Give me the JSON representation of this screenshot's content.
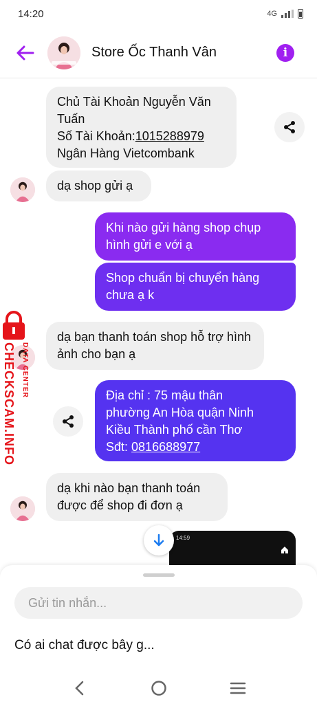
{
  "status_bar": {
    "time": "14:20",
    "network": "4G"
  },
  "header": {
    "title": "Store Ốc Thanh Vân"
  },
  "messages": [
    {
      "lines": [
        "Chủ Tài Khoản Nguyễn Văn",
        "Tuấn",
        "Số Tài Khoản:",
        "1015288979",
        "Ngân Hàng Vietcombank"
      ]
    },
    {
      "text": "dạ shop gửi ạ"
    },
    {
      "text": "Khi nào gửi hàng shop chụp hình gửi e với ạ"
    },
    {
      "text": "Shop chuẩn bị chuyển hàng chưa ạ k"
    },
    {
      "text": "dạ bạn thanh toán shop hỗ trợ hình ảnh cho bạn ạ"
    },
    {
      "lines": [
        "Địa chỉ : 75 mậu thân",
        "phường An Hòa quận Ninh",
        "Kiều Thành phố cần Thơ",
        "Sđt: ",
        "0816688977"
      ]
    },
    {
      "text": "dạ khi nào bạn thanh toán được để shop đi đơn ạ"
    }
  ],
  "watermark": {
    "line1": "DATA CENTER",
    "line2": "CHECKSCAM.INFO"
  },
  "phone_thumb": {
    "time": "14:59"
  },
  "composer": {
    "placeholder": "Gửi tin nhắn...",
    "suggestion": "Có ai chat được bây g..."
  },
  "colors": {
    "accent": "#a020f0",
    "outgoing_top": "#8a2bf0",
    "outgoing_bottom": "#5533f0",
    "incoming": "#efefef"
  },
  "icons": [
    "back-arrow-icon",
    "info-icon",
    "share-icon",
    "arrow-down-icon",
    "home-icon",
    "nav-back-icon",
    "nav-home-icon",
    "nav-menu-icon",
    "lock-icon"
  ]
}
